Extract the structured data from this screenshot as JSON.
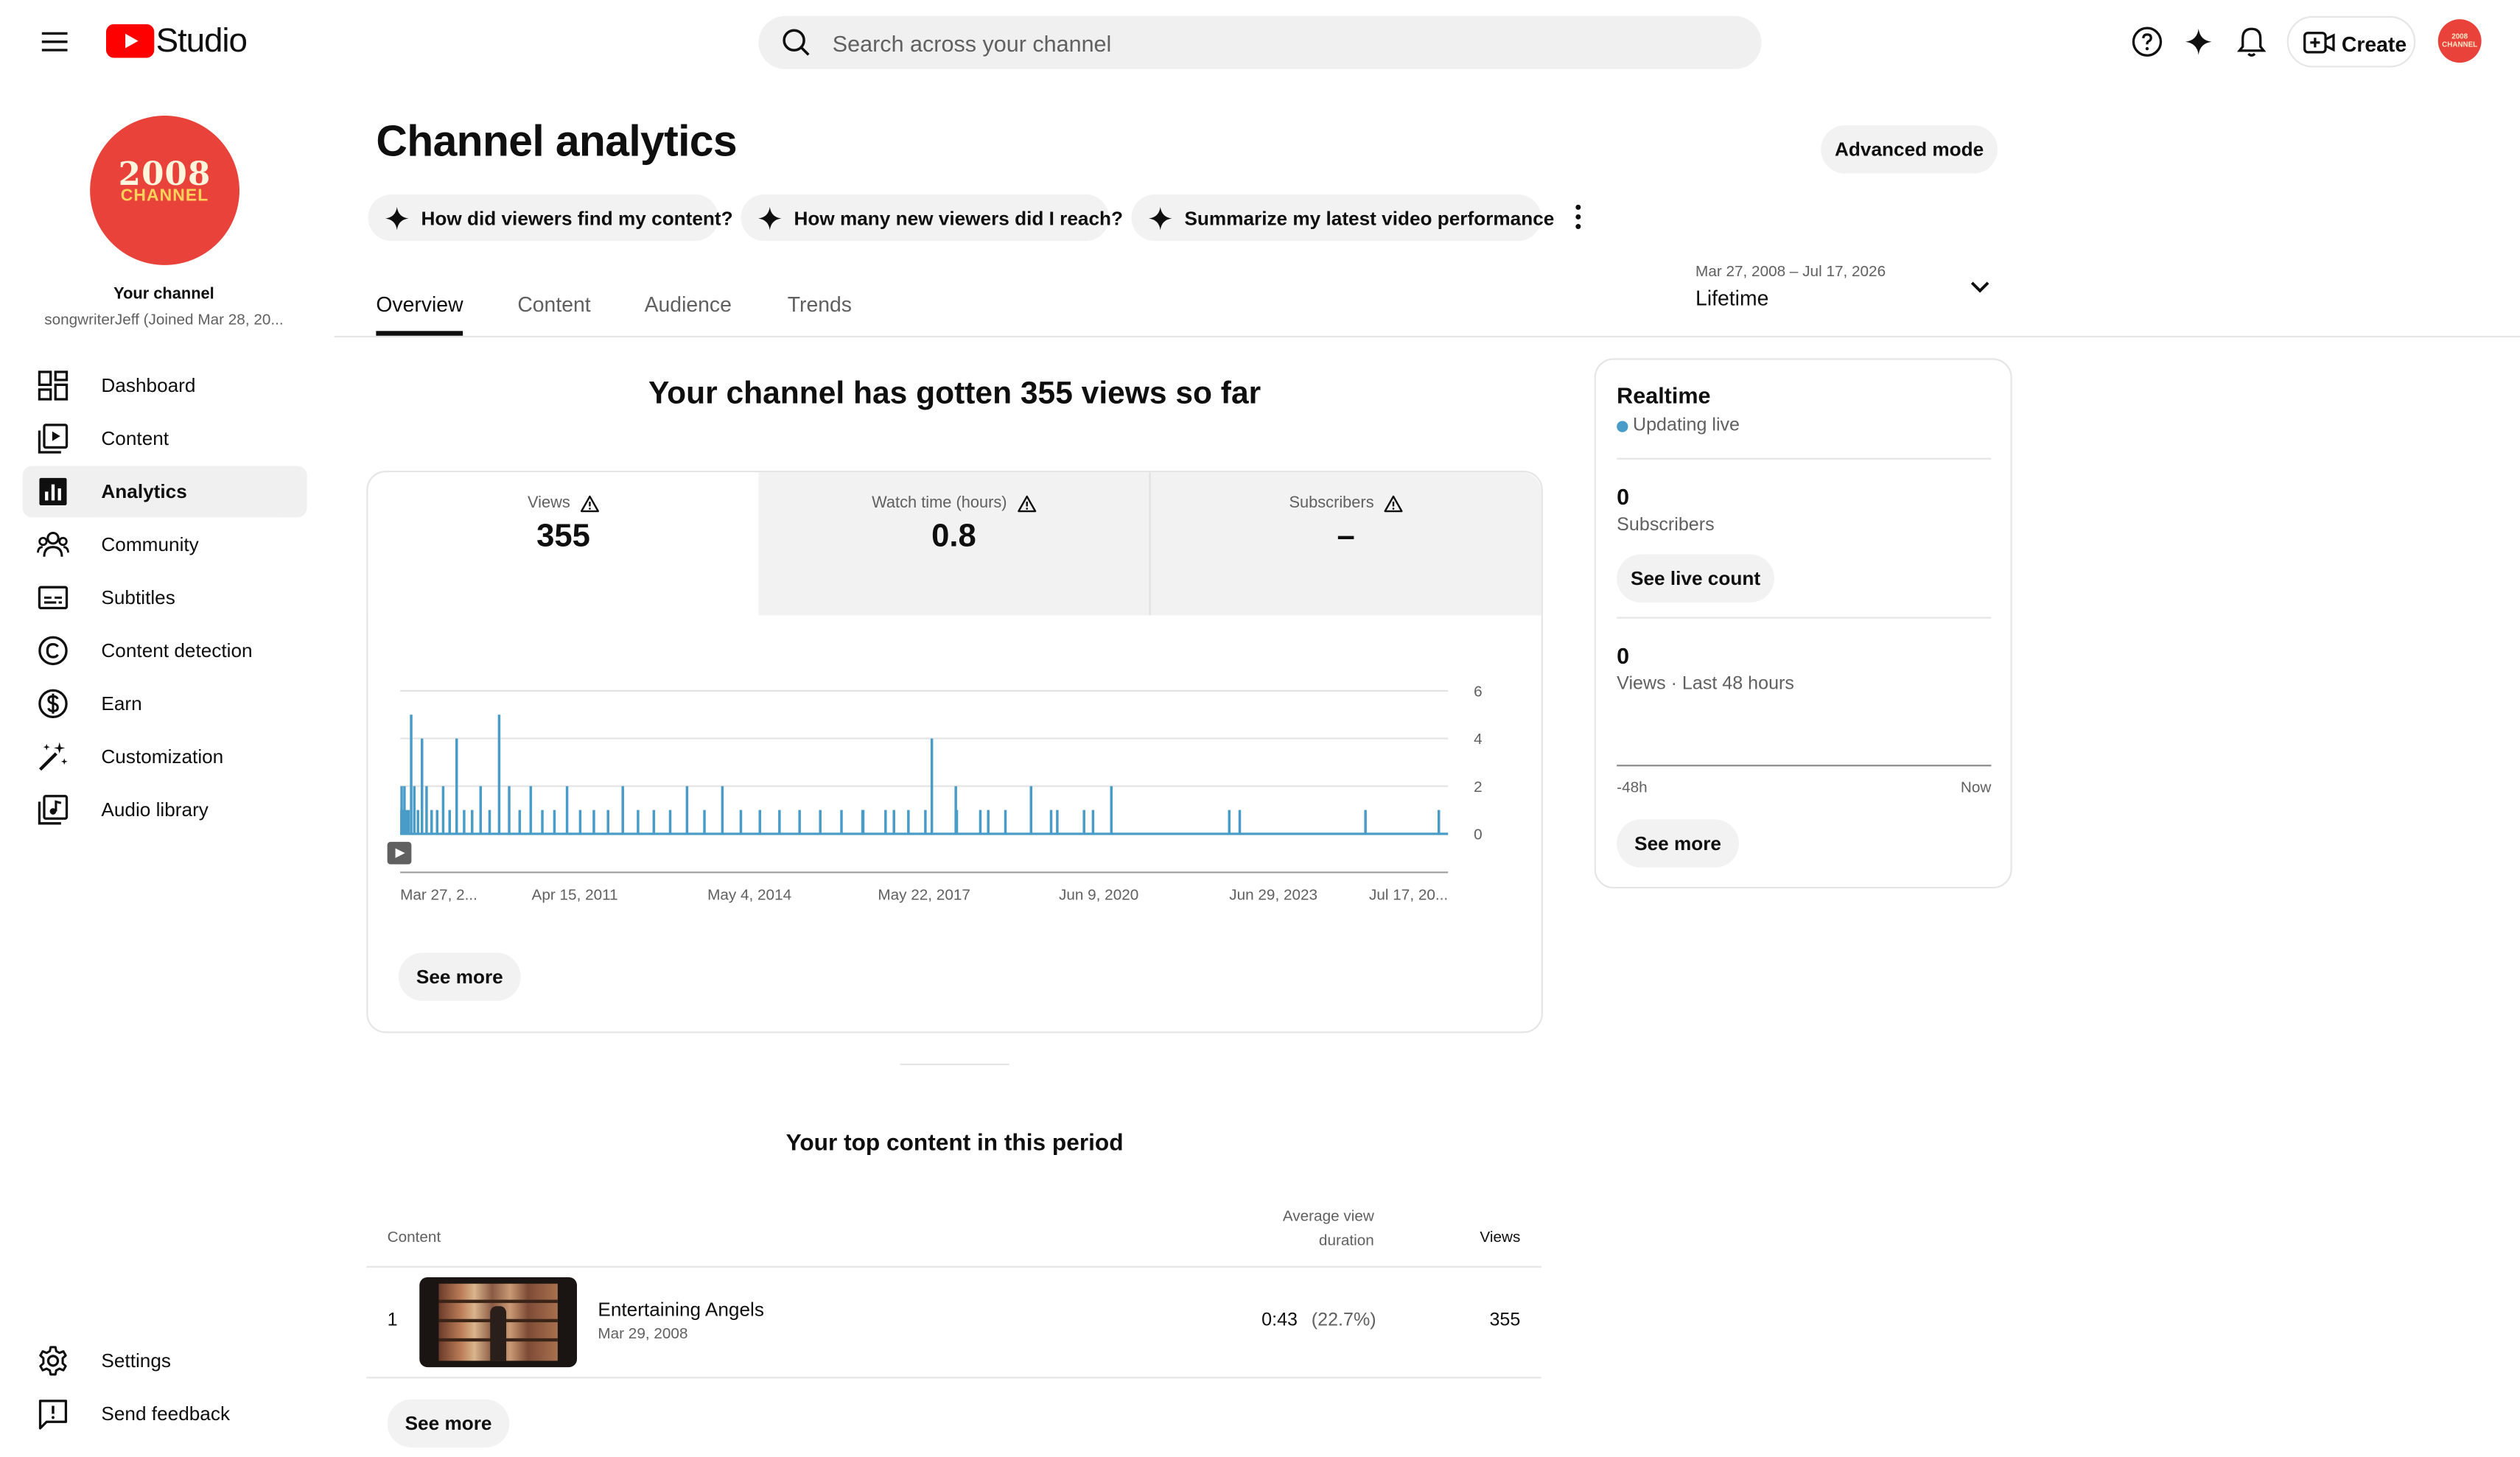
{
  "header": {
    "logo_text": "Studio",
    "search_placeholder": "Search across your channel",
    "create_label": "Create",
    "avatar_text": "2008 CHANNEL"
  },
  "sidebar": {
    "avatar_line1": "2008",
    "avatar_line2": "CHANNEL",
    "channel_title": "Your channel",
    "channel_sub": "songwriterJeff (Joined Mar 28, 20...",
    "items": [
      {
        "label": "Dashboard",
        "icon": "dashboard-icon"
      },
      {
        "label": "Content",
        "icon": "content-icon"
      },
      {
        "label": "Analytics",
        "icon": "analytics-icon",
        "active": true
      },
      {
        "label": "Community",
        "icon": "community-icon"
      },
      {
        "label": "Subtitles",
        "icon": "subtitles-icon"
      },
      {
        "label": "Content detection",
        "icon": "copyright-icon"
      },
      {
        "label": "Earn",
        "icon": "dollar-icon"
      },
      {
        "label": "Customization",
        "icon": "magic-wand-icon"
      },
      {
        "label": "Audio library",
        "icon": "audio-library-icon"
      }
    ],
    "settings_label": "Settings",
    "feedback_label": "Send feedback"
  },
  "page": {
    "title": "Channel analytics",
    "advanced_mode": "Advanced mode",
    "chips": [
      "How did viewers find my content?",
      "How many new viewers did I reach?",
      "Summarize my latest video performance"
    ],
    "tabs": [
      "Overview",
      "Content",
      "Audience",
      "Trends"
    ],
    "date_range": "Mar 27, 2008 – Jul 17, 2026",
    "date_period": "Lifetime"
  },
  "overview": {
    "headline": "Your channel has gotten 355 views so far",
    "metrics": [
      {
        "label": "Views",
        "value": "355"
      },
      {
        "label": "Watch time (hours)",
        "value": "0.8"
      },
      {
        "label": "Subscribers",
        "value": "–"
      }
    ],
    "see_more": "See more"
  },
  "chart_data": {
    "type": "bar",
    "title": "",
    "xlabel": "",
    "ylabel": "",
    "ylim": [
      0,
      6
    ],
    "yticks": [
      0,
      2,
      4,
      6
    ],
    "x_tick_labels": [
      "Mar 27, 2...",
      "Apr 15, 2011",
      "May 4, 2014",
      "May 22, 2017",
      "Jun 9, 2020",
      "Jun 29, 2023",
      "Jul 17, 20..."
    ],
    "grid": true,
    "series": [
      {
        "values": [
          1,
          2,
          1,
          1,
          2,
          1,
          1,
          5,
          2,
          1,
          4,
          2,
          1,
          1,
          2,
          1,
          4,
          1,
          1,
          2,
          1,
          5,
          2,
          1,
          2,
          1,
          1,
          2,
          1,
          1,
          1,
          2,
          1,
          1,
          1,
          2,
          1,
          2,
          1,
          1,
          1,
          1,
          1,
          1,
          1,
          1,
          1,
          4,
          2,
          1,
          1,
          2,
          1,
          1,
          2,
          1,
          1,
          1,
          1,
          1,
          1,
          1,
          1,
          1,
          1,
          1
        ]
      }
    ]
  },
  "realtime": {
    "title": "Realtime",
    "status": "Updating live",
    "subs_value": "0",
    "subs_label": "Subscribers",
    "live_count_button": "See live count",
    "views_value": "0",
    "views_label": "Views · Last 48 hours",
    "axis_start": "-48h",
    "axis_end": "Now",
    "see_more": "See more"
  },
  "top_content": {
    "title": "Your top content in this period",
    "col_content": "Content",
    "col_avd_1": "Average view",
    "col_avd_2": "duration",
    "col_views": "Views",
    "rows": [
      {
        "rank": "1",
        "title": "Entertaining Angels",
        "date": "Mar 29, 2008",
        "avd": "0:43",
        "avd_pct": "(22.7%)",
        "views": "355"
      }
    ],
    "see_more": "See more"
  },
  "colors": {
    "brand_red": "#ff0000",
    "chart_blue": "#4a9cc8",
    "avatar_red": "#e8423a"
  }
}
